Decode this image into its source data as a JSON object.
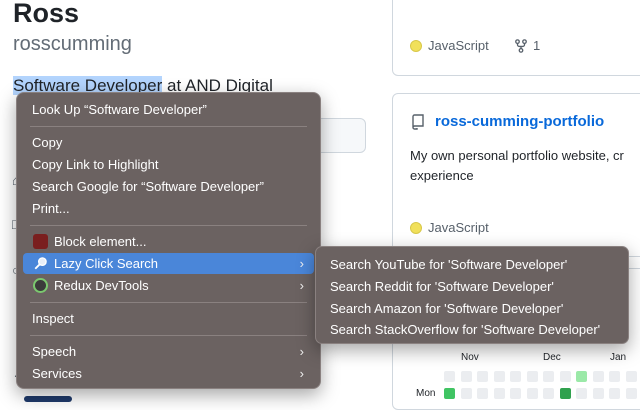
{
  "profile": {
    "name": "Ross",
    "login": "rosscumming",
    "bio_selected": "Software Developer",
    "bio_rest": " at AND Digital"
  },
  "repo_cards": {
    "top": {
      "language": "JavaScript",
      "forks": "1"
    },
    "portfolio": {
      "name": "ross-cumming-portfolio",
      "description_line1": "My own personal portfolio website, cr",
      "description_line2": "experience",
      "language": "JavaScript"
    }
  },
  "contributions": {
    "months": [
      "Nov",
      "Dec",
      "Jan"
    ],
    "day_label": "Mon"
  },
  "context_menu": {
    "items": [
      {
        "label": "Look Up “Software Developer”"
      },
      {
        "label": "Copy"
      },
      {
        "label": "Copy Link to Highlight"
      },
      {
        "label": "Search Google for “Software Developer”"
      },
      {
        "label": "Print..."
      },
      {
        "label": "Block element...",
        "icon": "ublock-icon"
      },
      {
        "label": "Lazy Click Search",
        "icon": "magnifier-icon",
        "submenu": true,
        "highlighted": true
      },
      {
        "label": "Redux DevTools",
        "icon": "redux-icon",
        "submenu": true
      },
      {
        "label": "Inspect"
      },
      {
        "label": "Speech",
        "submenu": true
      },
      {
        "label": "Services",
        "submenu": true
      }
    ],
    "submenu_arrow": "›"
  },
  "lazy_click_submenu": {
    "items": [
      "Search YouTube for 'Software Developer'",
      "Search Reddit for 'Software Developer'",
      "Search Amazon for 'Software Developer'",
      "Search StackOverflow for 'Software Developer'"
    ]
  },
  "colors": {
    "menu_background": "#6b6261",
    "menu_highlight": "#4a86d9",
    "link_blue": "#0969da",
    "javascript_dot": "#f1e05a",
    "selection": "#b3d4fd"
  }
}
